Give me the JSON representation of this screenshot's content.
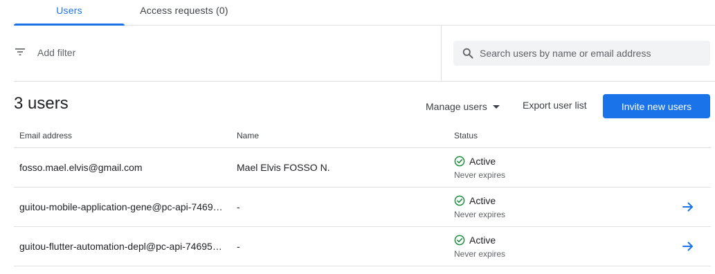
{
  "tabs": [
    {
      "label": "Users",
      "active": true
    },
    {
      "label": "Access requests (0)",
      "active": false
    }
  ],
  "filter": {
    "label": "Add filter",
    "icon": "filter-list-icon"
  },
  "search": {
    "placeholder": "Search users by name or email address",
    "value": "",
    "icon": "search-icon"
  },
  "summary": {
    "count_label": "3 users"
  },
  "actions": {
    "manage_label": "Manage users",
    "export_label": "Export user list",
    "invite_label": "Invite new users"
  },
  "table": {
    "columns": [
      "Email address",
      "Name",
      "Status"
    ],
    "rows": [
      {
        "email": "fosso.mael.elvis@gmail.com",
        "name": "Mael Elvis FOSSO N.",
        "status": "Active",
        "expiry": "Never expires",
        "has_arrow": false
      },
      {
        "email": "guitou-mobile-application-gene@pc-api-7469…",
        "name": "-",
        "status": "Active",
        "expiry": "Never expires",
        "has_arrow": true
      },
      {
        "email": "guitou-flutter-automation-depl@pc-api-74695…",
        "name": "-",
        "status": "Active",
        "expiry": "Never expires",
        "has_arrow": true
      }
    ]
  },
  "colors": {
    "accent": "#1a73e8",
    "success": "#1e8e3e",
    "border": "#e0e0e0",
    "search_bg": "#f1f3f4"
  }
}
